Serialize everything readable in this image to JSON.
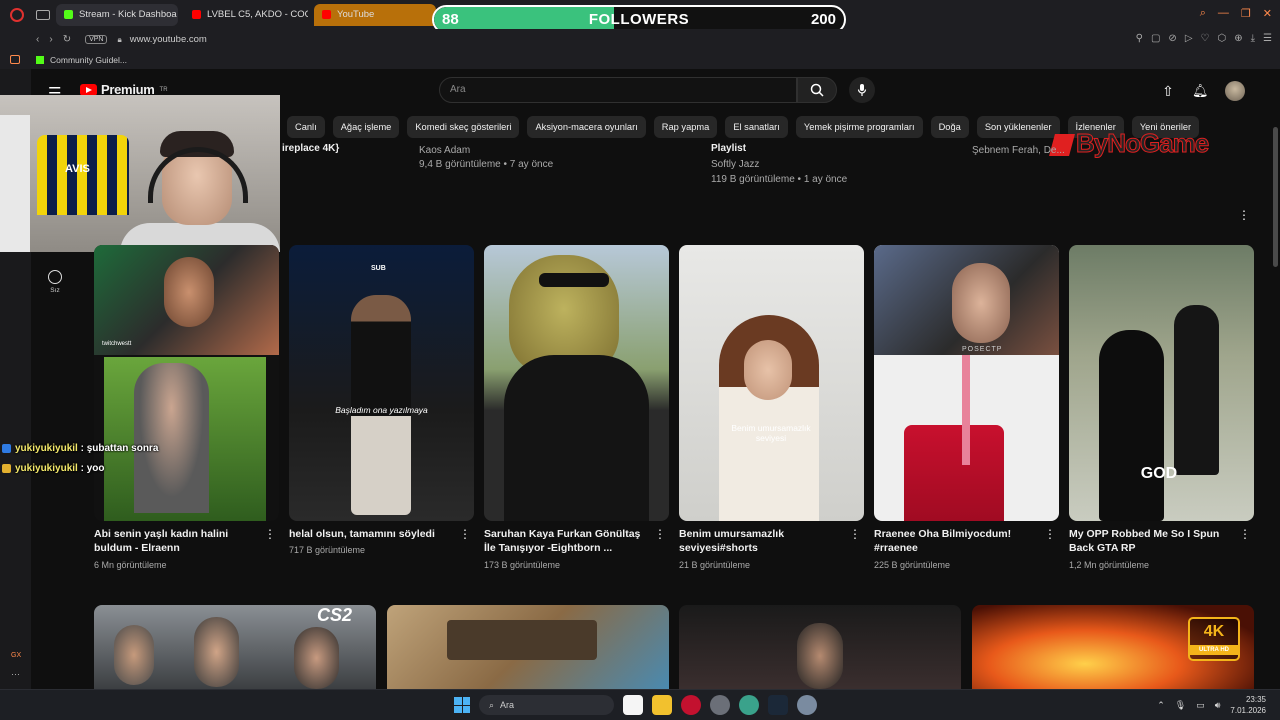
{
  "browser": {
    "tabs": [
      {
        "label": "Stream - Kick Dashboa",
        "active": true
      },
      {
        "label": "LVBEL C5, AKDO - COOO"
      },
      {
        "label": "YouTube"
      }
    ],
    "url": "www.youtube.com",
    "vpn_label": "VPN",
    "bookmark": "Community Guidel..."
  },
  "overlay": {
    "followers_current": "88",
    "followers_label": "FOLLOWERS",
    "followers_goal": "200",
    "followers_progress": 0.44,
    "sponsor": "ByNoGame"
  },
  "youtube": {
    "logo": "Premium",
    "logo_region": "TR",
    "search_placeholder": "Ara",
    "sidebar_you": "Sız",
    "chips": [
      "Canlı",
      "Ağaç işleme",
      "Komedi skeç gösterileri",
      "Aksiyon-macera oyunları",
      "Rap yapma",
      "El sanatları",
      "Yemek pişirme programları",
      "Doğa",
      "Son yüklenenler",
      "İzlenenler",
      "Yeni öneriler"
    ]
  },
  "previous_row": [
    {
      "title": "ireplace 4K}",
      "channel": "",
      "meta": ""
    },
    {
      "title": "",
      "channel": "Kaos Adam",
      "meta": "9,4 B görüntüleme • 7 ay önce"
    },
    {
      "title": "Playlist",
      "channel": "Softly Jazz",
      "meta": "119 B görüntüleme • 1 ay önce"
    },
    {
      "title": "",
      "channel": "Şebnem Ferah, De...",
      "meta": ""
    }
  ],
  "shorts": [
    {
      "title": "Abi senin yaşlı kadın halini buldum - Elraenn",
      "meta": "6 Mn görüntüleme",
      "overlay": "",
      "tag": "twitchwestt"
    },
    {
      "title": "helal olsun, tamamını söyledi",
      "meta": "717 B görüntüleme",
      "overlay": "Başladım ona yazılmaya",
      "tag": "SUB"
    },
    {
      "title": "Saruhan Kaya  Furkan Gönültaş İle Tanışıyor -Eightborn ...",
      "meta": "173 B görüntüleme",
      "overlay": "",
      "tag": ""
    },
    {
      "title": "Benim umursamazlık seviyesi#shorts",
      "meta": "21 B görüntüleme",
      "overlay": "Benim umursamazlık seviyesi",
      "tag": ""
    },
    {
      "title": "Rraenee Oha Bilmiyocdum! #rraenee",
      "meta": "225 B görüntüleme",
      "overlay": "",
      "tag": "POSECTP"
    },
    {
      "title": "My OPP Robbed Me So I Spun Back GTA RP",
      "meta": "1,2 Mn görüntüleme",
      "overlay": "GOD",
      "tag": ""
    }
  ],
  "bottom_videos": [
    {
      "badge": "CS2"
    },
    {
      "badge": ""
    },
    {
      "badge": ""
    },
    {
      "badge": "4K",
      "badge_sub": "ULTRA HD"
    }
  ],
  "chat": [
    {
      "user": "yukiyukiyukil",
      "message": ": şubattan sonra"
    },
    {
      "user": "yukiyukiyukil",
      "message": ": yoo"
    }
  ],
  "taskbar": {
    "search": "Ara",
    "time": "23:35",
    "date": "7.01.2026"
  },
  "opera_sidebar": {
    "gx": "GX"
  },
  "colors": {
    "accent_followers": "#3ac27d",
    "youtube_red": "#ff0000",
    "kick_green": "#53fc18"
  }
}
